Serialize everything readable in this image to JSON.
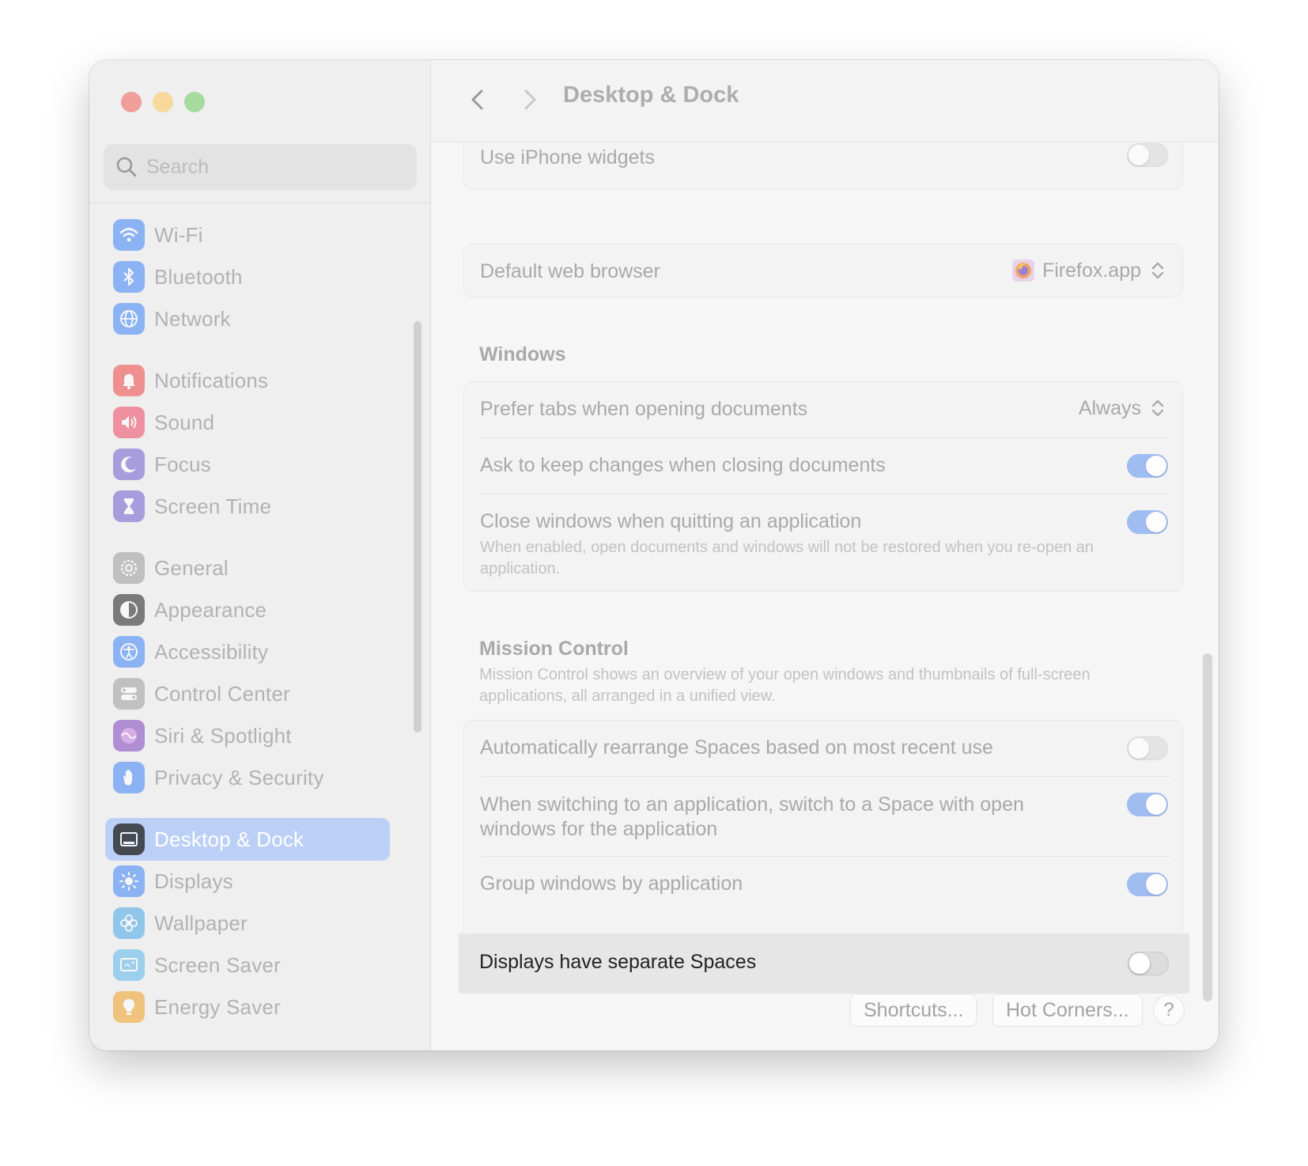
{
  "search": {
    "placeholder": "Search"
  },
  "sidebar": {
    "items": [
      {
        "label": "Wi-Fi",
        "icon": "wifi-icon",
        "color": "#3b82f6"
      },
      {
        "label": "Bluetooth",
        "icon": "bluetooth-icon",
        "color": "#3b82f6"
      },
      {
        "label": "Network",
        "icon": "globe-icon",
        "color": "#3b82f6"
      },
      {
        "label": "Notifications",
        "icon": "bell-icon",
        "color": "#ef4444"
      },
      {
        "label": "Sound",
        "icon": "speaker-icon",
        "color": "#ef4461"
      },
      {
        "label": "Focus",
        "icon": "moon-icon",
        "color": "#6d5bd0"
      },
      {
        "label": "Screen Time",
        "icon": "hourglass-icon",
        "color": "#6d5bd0"
      },
      {
        "label": "General",
        "icon": "gear-icon",
        "color": "#9a9a9a"
      },
      {
        "label": "Appearance",
        "icon": "appearance-icon",
        "color": "#1c1c1c"
      },
      {
        "label": "Accessibility",
        "icon": "accessibility-icon",
        "color": "#3b82f6"
      },
      {
        "label": "Control Center",
        "icon": "control-center-icon",
        "color": "#9a9a9a"
      },
      {
        "label": "Siri & Spotlight",
        "icon": "siri-icon",
        "color": "#7b3fbf"
      },
      {
        "label": "Privacy & Security",
        "icon": "hand-icon",
        "color": "#3b82f6"
      },
      {
        "label": "Desktop & Dock",
        "icon": "dock-icon",
        "color": "#1c1c1c",
        "selected": true
      },
      {
        "label": "Displays",
        "icon": "sun-icon",
        "color": "#3b82f6"
      },
      {
        "label": "Wallpaper",
        "icon": "flower-icon",
        "color": "#46a6e8"
      },
      {
        "label": "Screen Saver",
        "icon": "screen-saver-icon",
        "color": "#5ab6e8"
      },
      {
        "label": "Energy Saver",
        "icon": "bulb-icon",
        "color": "#f0a020"
      }
    ]
  },
  "header": {
    "title": "Desktop & Dock"
  },
  "widgets": {
    "iphone_label": "Use iPhone widgets",
    "iphone_on": false
  },
  "browser": {
    "label": "Default web browser",
    "value": "Firefox.app"
  },
  "windows": {
    "title": "Windows",
    "prefer_tabs_label": "Prefer tabs when opening documents",
    "prefer_tabs_value": "Always",
    "ask_keep_label": "Ask to keep changes when closing documents",
    "ask_keep_on": true,
    "close_windows_label": "Close windows when quitting an application",
    "close_windows_desc": "When enabled, open documents and windows will not be restored when you re-open an application.",
    "close_windows_on": true
  },
  "mission_control": {
    "title": "Mission Control",
    "desc": "Mission Control shows an overview of your open windows and thumbnails of full-screen applications, all arranged in a unified view.",
    "rearrange_label": "Automatically rearrange Spaces based on most recent use",
    "rearrange_on": false,
    "switch_label": "When switching to an application, switch to a Space with open windows for the application",
    "switch_on": true,
    "group_label": "Group windows by application",
    "group_on": true,
    "separate_label": "Displays have separate Spaces",
    "separate_on": false
  },
  "buttons": {
    "shortcuts": "Shortcuts...",
    "hot_corners": "Hot Corners...",
    "help": "?"
  },
  "colors": {
    "accent": "#3478f6",
    "selected_sidebar": "#bcd0f7"
  }
}
